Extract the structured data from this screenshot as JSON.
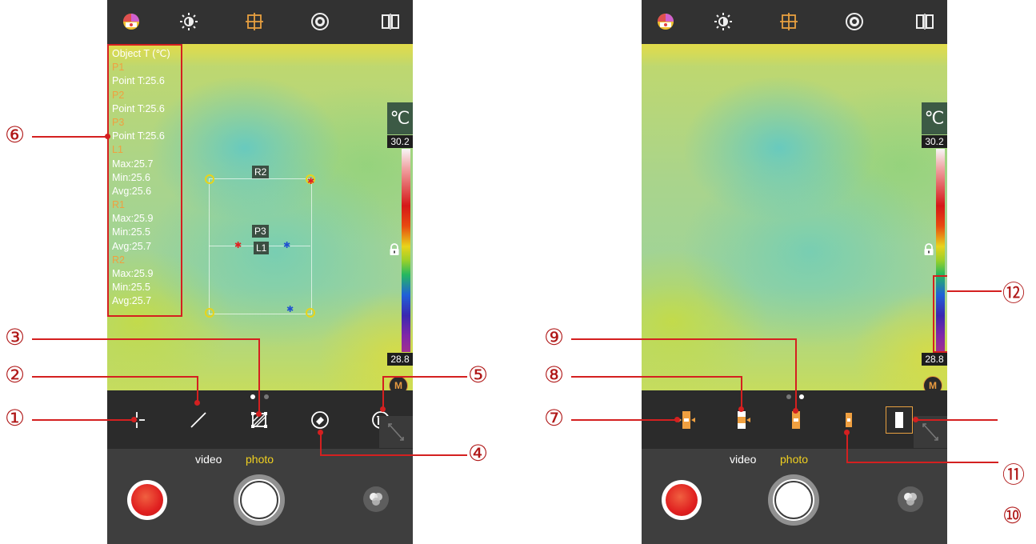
{
  "left_screen": {
    "unit": "℃",
    "scale_max": "30.2",
    "scale_min": "28.8",
    "measure_button": "M",
    "measurement_panel": [
      {
        "text": "Object T (℃)",
        "color": "white"
      },
      {
        "text": "P1",
        "color": "orange"
      },
      {
        "text": "Point T:25.6",
        "color": "white"
      },
      {
        "text": "P2",
        "color": "orange"
      },
      {
        "text": "Point T:25.6",
        "color": "white"
      },
      {
        "text": "P3",
        "color": "orange"
      },
      {
        "text": "Point T:25.6",
        "color": "white"
      },
      {
        "text": "L1",
        "color": "orange"
      },
      {
        "text": "Max:25.7",
        "color": "white"
      },
      {
        "text": "Min:25.6",
        "color": "white"
      },
      {
        "text": "Avg:25.6",
        "color": "white"
      },
      {
        "text": "R1",
        "color": "orange"
      },
      {
        "text": "Max:25.9",
        "color": "white"
      },
      {
        "text": "Min:25.5",
        "color": "white"
      },
      {
        "text": "Avg:25.7",
        "color": "white"
      },
      {
        "text": "R2",
        "color": "orange"
      },
      {
        "text": "Max:25.9",
        "color": "white"
      },
      {
        "text": "Min:25.5",
        "color": "white"
      },
      {
        "text": "Avg:25.7",
        "color": "white"
      }
    ],
    "overlay_labels": {
      "r2": "R2",
      "p3": "P3",
      "l1": "L1"
    },
    "modes": {
      "video": "video",
      "photo": "photo"
    }
  },
  "right_screen": {
    "unit": "℃",
    "scale_max": "30.2",
    "scale_min": "28.8",
    "measure_button": "M",
    "modes": {
      "video": "video",
      "photo": "photo"
    }
  },
  "callouts": {
    "c1": "①",
    "c2": "②",
    "c3": "③",
    "c4": "④",
    "c5": "⑤",
    "c6": "⑥",
    "c7": "⑦",
    "c8": "⑧",
    "c9": "⑨",
    "c10": "⑩",
    "c11": "⑪",
    "c12": "⑫"
  },
  "icons": [
    "palette-icon",
    "brightness-icon",
    "target-icon",
    "aperture-icon",
    "compare-icon",
    "point-tool-icon",
    "line-tool-icon",
    "region-tool-icon",
    "eraser-icon",
    "delete-icon",
    "lock-icon",
    "expand-icon",
    "filters-icon",
    "record-button-icon",
    "shutter-icon"
  ],
  "colors": {
    "accent_orange": "#e8a040",
    "photo_yellow": "#f0d020",
    "callout_red": "#d42020"
  }
}
